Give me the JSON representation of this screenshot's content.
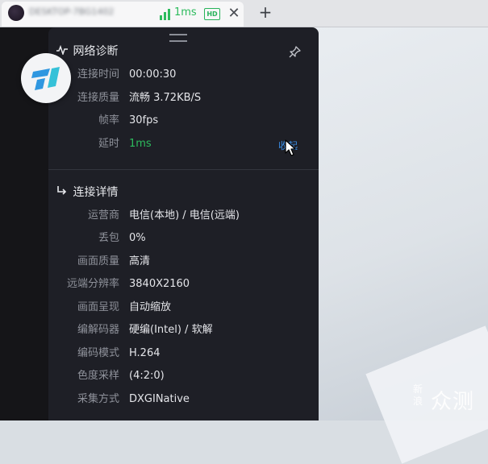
{
  "tab": {
    "title": "DESKTOP-7BG1402",
    "latency": "1ms",
    "hd_badge": "HD",
    "close_glyph": "✕",
    "new_tab_glyph": "+"
  },
  "diagnostics": {
    "title": "网络诊断",
    "rows": [
      {
        "label": "连接时间",
        "value": "00:00:30"
      },
      {
        "label": "连接质量",
        "value": "流畅 3.72KB/S"
      },
      {
        "label": "帧率",
        "value": "30fps"
      },
      {
        "label": "延时",
        "value": "1ms"
      }
    ],
    "collapse_label": "收起"
  },
  "details": {
    "title": "连接详情",
    "rows": [
      {
        "label": "运营商",
        "value": "电信(本地) / 电信(远端)"
      },
      {
        "label": "丢包",
        "value": "0%"
      },
      {
        "label": "画面质量",
        "value": "高清"
      },
      {
        "label": "远端分辨率",
        "value": "3840X2160"
      },
      {
        "label": "画面呈现",
        "value": "自动缩放"
      },
      {
        "label": "编解码器",
        "value": "硬编(Intel) / 软解"
      },
      {
        "label": "编码模式",
        "value": "H.264"
      },
      {
        "label": "色度采样",
        "value": "(4:2:0)"
      },
      {
        "label": "采集方式",
        "value": "DXGINative"
      }
    ]
  },
  "watermark": {
    "small": "新浪",
    "big": "众测"
  },
  "colors": {
    "panel_bg": "#1e1f26",
    "latency_green": "#2dbb5d",
    "link_blue": "#3a8ee6",
    "logo_blue": "#2f97e0",
    "logo_cyan": "#35c1d8"
  },
  "icons": {
    "pulse": "pulse-icon",
    "pin": "pin-icon",
    "signal": "signal-bars-icon",
    "detail_arrow": "arrow-turn-icon"
  }
}
